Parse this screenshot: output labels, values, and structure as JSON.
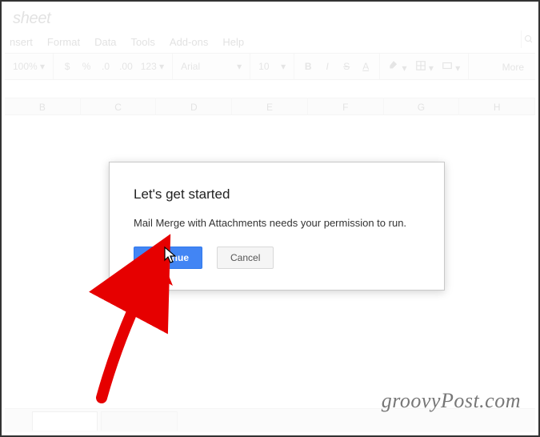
{
  "window": {
    "title_fragment": "sheet"
  },
  "menu": {
    "items": [
      "nsert",
      "Format",
      "Data",
      "Tools",
      "Add-ons",
      "Help"
    ]
  },
  "toolbar": {
    "zoom": "100%",
    "currency": "$",
    "percent": "%",
    "dec_dec": ".0",
    "dec_inc": ".00",
    "num_format": "123",
    "font": "Arial",
    "size": "10",
    "bold": "B",
    "italic": "I",
    "strike": "S",
    "underline": "A",
    "more": "More"
  },
  "columns": [
    "B",
    "C",
    "D",
    "E",
    "F",
    "G",
    "H"
  ],
  "dialog": {
    "title": "Let's get started",
    "message": "Mail Merge with Attachments needs your permission to run.",
    "continue": "Continue",
    "cancel": "Cancel"
  },
  "watermark": "groovyPost.com"
}
